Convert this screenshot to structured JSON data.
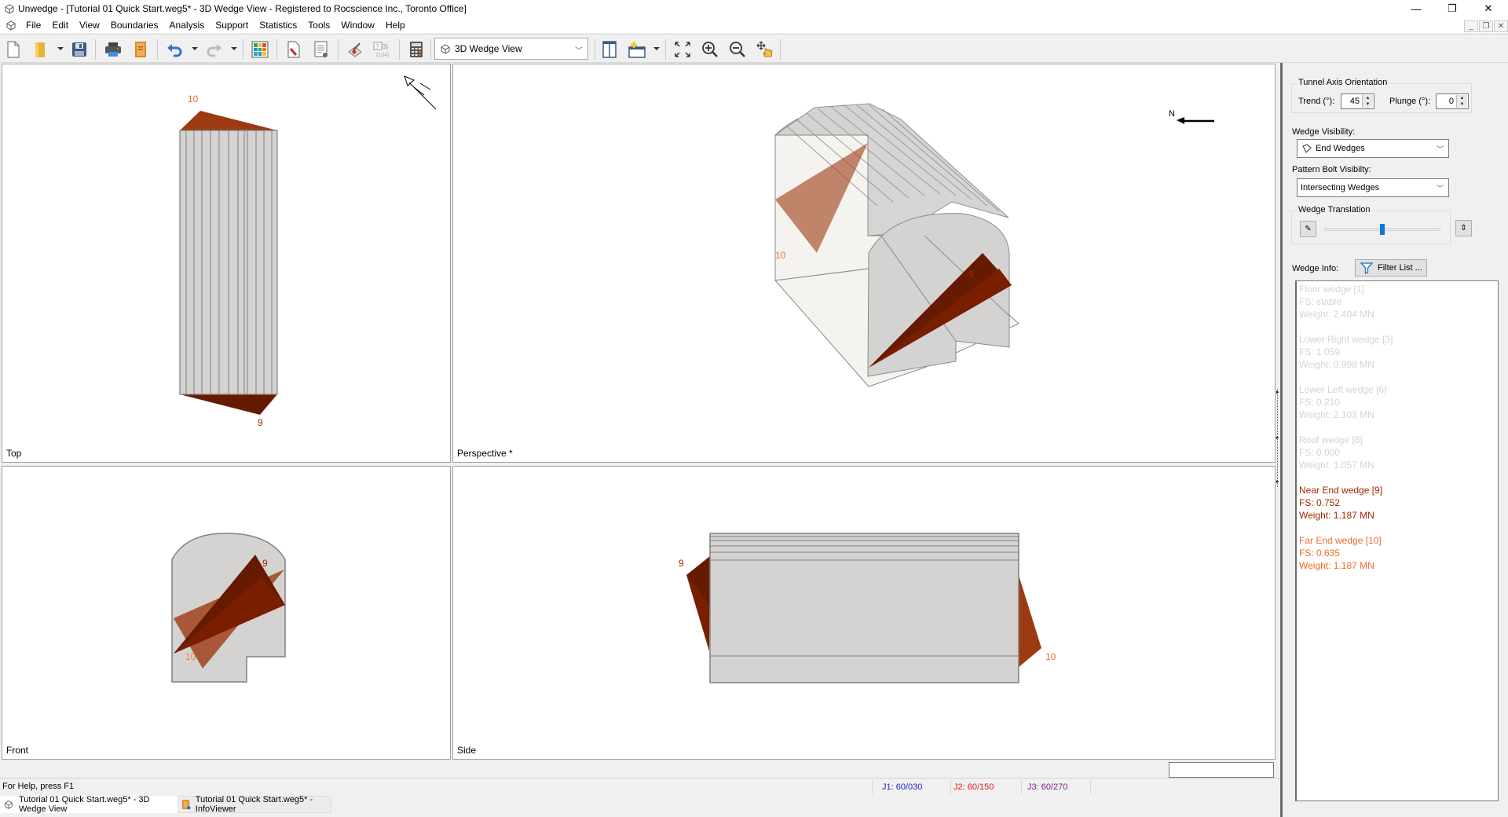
{
  "window": {
    "title": "Unwedge - [Tutorial 01 Quick Start.weg5* - 3D Wedge View - Registered to Rocscience Inc., Toronto Office]",
    "controls": {
      "minimize": "—",
      "restore": "❐",
      "close": "✕"
    },
    "mdi_controls": {
      "minimize": "_",
      "restore": "❐",
      "close": "✕"
    }
  },
  "menu": {
    "items": [
      "File",
      "Edit",
      "View",
      "Boundaries",
      "Analysis",
      "Support",
      "Statistics",
      "Tools",
      "Window",
      "Help"
    ]
  },
  "toolbar": {
    "icons": [
      "new-file-icon",
      "open-folder-icon",
      "save-icon",
      "print-icon",
      "info-viewer-icon",
      "undo-icon",
      "redo-icon",
      "color-grid-icon",
      "wedge-pick-icon",
      "report-icon",
      "joint-edit-icon",
      "numbering-icon",
      "calculator-icon",
      "pane-layout-icon",
      "add-view-icon",
      "zoom-extents-icon",
      "zoom-in-icon",
      "zoom-out-icon",
      "pan-icon"
    ],
    "view_select": {
      "value": "3D Wedge View"
    }
  },
  "viewports": {
    "top": {
      "label": "Top",
      "wedge_labels": {
        "far": "10",
        "near": "9"
      }
    },
    "perspective": {
      "label": "Perspective *",
      "north_label": "N",
      "wedge_labels": {
        "far": "10",
        "near": "9"
      }
    },
    "front": {
      "label": "Front",
      "wedge_labels": {
        "far": "10",
        "near": "9"
      }
    },
    "side": {
      "label": "Side",
      "wedge_labels": {
        "far": "10",
        "near": "9"
      }
    }
  },
  "colors": {
    "near_wedge": "#661a00",
    "far_wedge": "#9c3a12",
    "near_text": "#a02800",
    "far_text": "#f06a2a",
    "inactive_text": "#d4d4d4",
    "tunnel_fill": "#d4d3d1",
    "tunnel_edge": "#808080",
    "j1": "#1f1fcf",
    "j2": "#e01b1b",
    "j3": "#8b1a8b",
    "slider": "#0a78d7"
  },
  "panel": {
    "tunnel_axis": {
      "title": "Tunnel Axis Orientation",
      "trend_label": "Trend (°):",
      "trend_value": "45",
      "plunge_label": "Plunge (°):",
      "plunge_value": "0"
    },
    "wedge_visibility": {
      "label": "Wedge Visibility:",
      "value": "End Wedges"
    },
    "pattern_bolt": {
      "label": "Pattern Bolt Visibilty:",
      "value": "Intersecting Wedges"
    },
    "wedge_translation": {
      "title": "Wedge Translation",
      "position_fraction": 0.5
    },
    "wedge_info": {
      "label": "Wedge Info:",
      "filter_button": "Filter List ...",
      "wedges": [
        {
          "name": "Floor wedge [1]",
          "fs": "FS: stable",
          "weight": "Weight: 2.404 MN",
          "state": "inactive"
        },
        {
          "name": "Lower Right wedge [3]",
          "fs": "FS: 1.059",
          "weight": "Weight: 0.998 MN",
          "state": "inactive"
        },
        {
          "name": "Lower Left wedge [6]",
          "fs": "FS: 0.210",
          "weight": "Weight: 2.103 MN",
          "state": "inactive"
        },
        {
          "name": "Roof wedge [8]",
          "fs": "FS: 0.000",
          "weight": "Weight: 1.057 MN",
          "state": "inactive"
        },
        {
          "name": "Near End wedge [9]",
          "fs": "FS: 0.752",
          "weight": "Weight: 1.187 MN",
          "state": "near"
        },
        {
          "name": "Far End wedge [10]",
          "fs": "FS: 0.635",
          "weight": "Weight: 1.187 MN",
          "state": "far"
        }
      ]
    }
  },
  "status": {
    "help": "For Help, press F1",
    "j1": "J1: 60/030",
    "j2": "J2: 60/150",
    "j3": "J3: 60/270"
  },
  "tasks": {
    "tab1": "Tutorial 01 Quick Start.weg5* - 3D Wedge View",
    "tab2": "Tutorial 01 Quick Start.weg5* - InfoViewer"
  }
}
